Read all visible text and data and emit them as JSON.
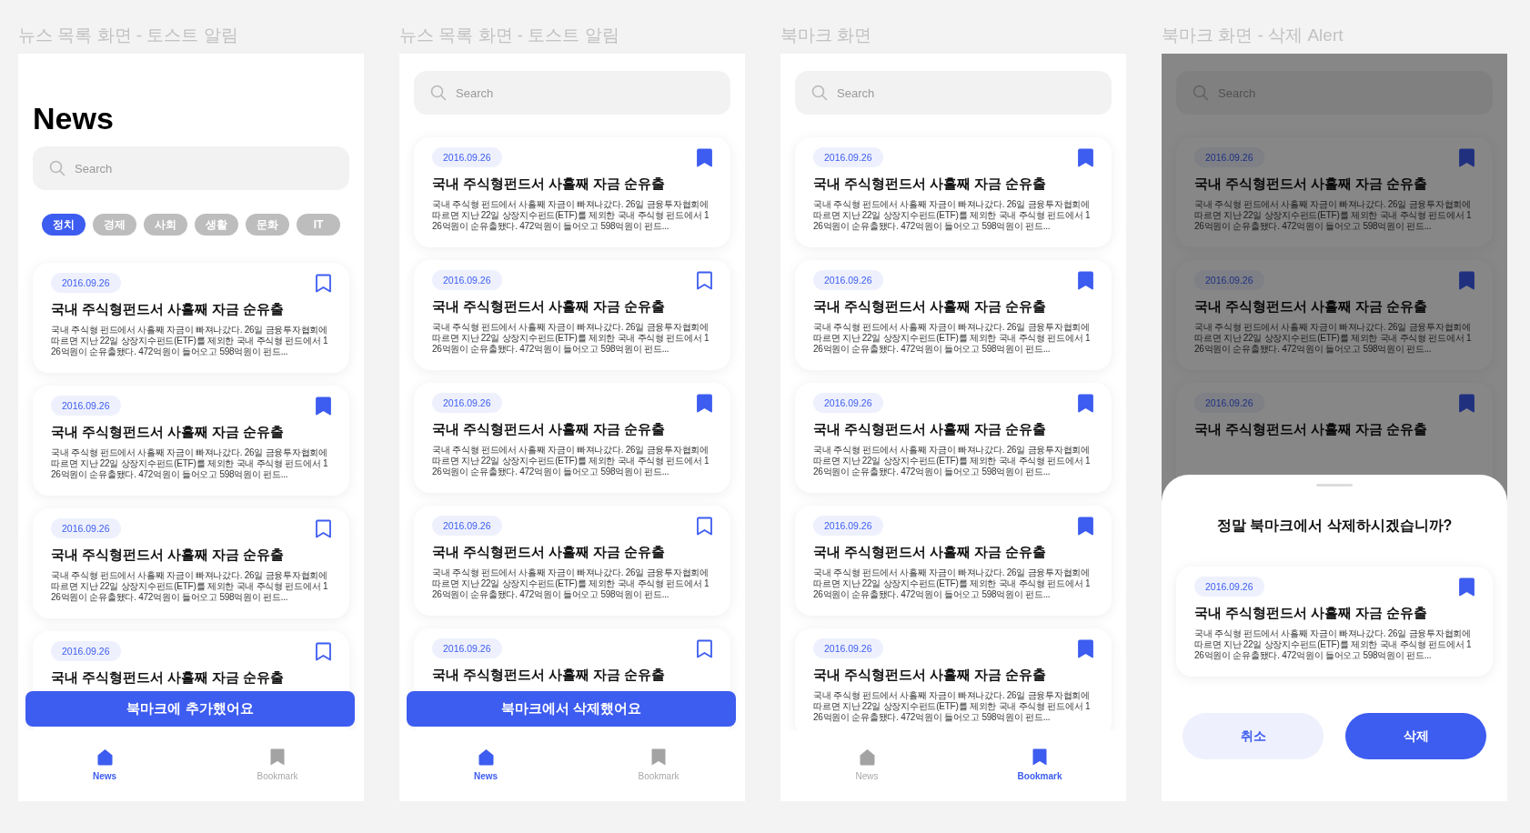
{
  "screens": [
    {
      "caption": "뉴스 목록 화면 - 토스트 알림",
      "header_title": "News",
      "search": {
        "placeholder": "Search"
      },
      "categories": [
        {
          "label": "정치",
          "selected": true
        },
        {
          "label": "경제",
          "selected": false
        },
        {
          "label": "사회",
          "selected": false
        },
        {
          "label": "생활",
          "selected": false
        },
        {
          "label": "문화",
          "selected": false
        },
        {
          "label": "IT",
          "selected": false
        }
      ],
      "articles": [
        {
          "date": "2016.09.26",
          "title": "국내 주식형펀드서 사흘째 자금 순유출",
          "body": "국내 주식형 펀드에서 사흘째 자금이 빠져나갔다. 26일 금융투자협회에 따르면 지난 22일 상장지수펀드(ETF)를 제외한 국내 주식형 펀드에서 126억원이 순유출됐다. 472억원이 들어오고 598억원이 펀드...",
          "bookmarked": false
        },
        {
          "date": "2016.09.26",
          "title": "국내 주식형펀드서 사흘째 자금 순유출",
          "body": "국내 주식형 펀드에서 사흘째 자금이 빠져나갔다. 26일 금융투자협회에 따르면 지난 22일 상장지수펀드(ETF)를 제외한 국내 주식형 펀드에서 126억원이 순유출됐다. 472억원이 들어오고 598억원이 펀드...",
          "bookmarked": true
        },
        {
          "date": "2016.09.26",
          "title": "국내 주식형펀드서 사흘째 자금 순유출",
          "body": "국내 주식형 펀드에서 사흘째 자금이 빠져나갔다. 26일 금융투자협회에 따르면 지난 22일 상장지수펀드(ETF)를 제외한 국내 주식형 펀드에서 126억원이 순유출됐다. 472억원이 들어오고 598억원이 펀드...",
          "bookmarked": false
        },
        {
          "date": "2016.09.26",
          "title": "국내 주식형펀드서 사흘째 자금 순유출",
          "bookmarked": false
        }
      ],
      "toast": "북마크에 추가했어요",
      "tabs": [
        {
          "label": "News",
          "selected": true
        },
        {
          "label": "Bookmark",
          "selected": false
        }
      ]
    },
    {
      "caption": "뉴스 목록 화면 - 토스트 알림",
      "search": {
        "placeholder": "Search"
      },
      "articles": [
        {
          "date": "2016.09.26",
          "title": "국내 주식형펀드서 사흘째 자금 순유출",
          "body": "국내 주식형 펀드에서 사흘째 자금이 빠져나갔다. 26일 금융투자협회에 따르면 지난 22일 상장지수펀드(ETF)를 제외한 국내 주식형 펀드에서 126억원이 순유출됐다. 472억원이 들어오고 598억원이 펀드...",
          "bookmarked": true
        },
        {
          "date": "2016.09.26",
          "title": "국내 주식형펀드서 사흘째 자금 순유출",
          "body": "국내 주식형 펀드에서 사흘째 자금이 빠져나갔다. 26일 금융투자협회에 따르면 지난 22일 상장지수펀드(ETF)를 제외한 국내 주식형 펀드에서 126억원이 순유출됐다. 472억원이 들어오고 598억원이 펀드...",
          "bookmarked": false
        },
        {
          "date": "2016.09.26",
          "title": "국내 주식형펀드서 사흘째 자금 순유출",
          "body": "국내 주식형 펀드에서 사흘째 자금이 빠져나갔다. 26일 금융투자협회에 따르면 지난 22일 상장지수펀드(ETF)를 제외한 국내 주식형 펀드에서 126억원이 순유출됐다. 472억원이 들어오고 598억원이 펀드...",
          "bookmarked": true
        },
        {
          "date": "2016.09.26",
          "title": "국내 주식형펀드서 사흘째 자금 순유출",
          "body": "국내 주식형 펀드에서 사흘째 자금이 빠져나갔다. 26일 금융투자협회에 따르면 지난 22일 상장지수펀드(ETF)를 제외한 국내 주식형 펀드에서 126억원이 순유출됐다. 472억원이 들어오고 598억원이 펀드...",
          "bookmarked": false
        },
        {
          "date": "2016.09.26",
          "title": "국내 주식형펀드서 사흘째 자금 순유출",
          "bookmarked": false
        }
      ],
      "toast": "북마크에서 삭제했어요",
      "tabs": [
        {
          "label": "News",
          "selected": true
        },
        {
          "label": "Bookmark",
          "selected": false
        }
      ]
    },
    {
      "caption": "북마크 화면",
      "search": {
        "placeholder": "Search"
      },
      "articles": [
        {
          "date": "2016.09.26",
          "title": "국내 주식형펀드서 사흘째 자금 순유출",
          "body": "국내 주식형 펀드에서 사흘째 자금이 빠져나갔다. 26일 금융투자협회에 따르면 지난 22일 상장지수펀드(ETF)를 제외한 국내 주식형 펀드에서 126억원이 순유출됐다. 472억원이 들어오고 598억원이 펀드...",
          "bookmarked": true
        },
        {
          "date": "2016.09.26",
          "title": "국내 주식형펀드서 사흘째 자금 순유출",
          "body": "국내 주식형 펀드에서 사흘째 자금이 빠져나갔다. 26일 금융투자협회에 따르면 지난 22일 상장지수펀드(ETF)를 제외한 국내 주식형 펀드에서 126억원이 순유출됐다. 472억원이 들어오고 598억원이 펀드...",
          "bookmarked": true
        },
        {
          "date": "2016.09.26",
          "title": "국내 주식형펀드서 사흘째 자금 순유출",
          "body": "국내 주식형 펀드에서 사흘째 자금이 빠져나갔다. 26일 금융투자협회에 따르면 지난 22일 상장지수펀드(ETF)를 제외한 국내 주식형 펀드에서 126억원이 순유출됐다. 472억원이 들어오고 598억원이 펀드...",
          "bookmarked": true
        },
        {
          "date": "2016.09.26",
          "title": "국내 주식형펀드서 사흘째 자금 순유출",
          "body": "국내 주식형 펀드에서 사흘째 자금이 빠져나갔다. 26일 금융투자협회에 따르면 지난 22일 상장지수펀드(ETF)를 제외한 국내 주식형 펀드에서 126억원이 순유출됐다. 472억원이 들어오고 598억원이 펀드...",
          "bookmarked": true
        },
        {
          "date": "2016.09.26",
          "title": "국내 주식형펀드서 사흘째 자금 순유출",
          "body": "국내 주식형 펀드에서 사흘째 자금이 빠져나갔다. 26일 금융투자협회에 따르면 지난 22일 상장지수펀드(ETF)를 제외한 국내 주식형 펀드에서 126억원이 순유출됐다. 472억원이 들어오고 598억원이 펀드...",
          "bookmarked": true
        }
      ],
      "tabs": [
        {
          "label": "News",
          "selected": false
        },
        {
          "label": "Bookmark",
          "selected": true
        }
      ]
    },
    {
      "caption": "북마크 화면 - 삭제 Alert",
      "search": {
        "placeholder": "Search"
      },
      "articles": [
        {
          "date": "2016.09.26",
          "title": "국내 주식형펀드서 사흘째 자금 순유출",
          "body": "국내 주식형 펀드에서 사흘째 자금이 빠져나갔다. 26일 금융투자협회에 따르면 지난 22일 상장지수펀드(ETF)를 제외한 국내 주식형 펀드에서 126억원이 순유출됐다. 472억원이 들어오고 598억원이 펀드...",
          "bookmarked": true
        },
        {
          "date": "2016.09.26",
          "title": "국내 주식형펀드서 사흘째 자금 순유출",
          "body": "국내 주식형 펀드에서 사흘째 자금이 빠져나갔다. 26일 금융투자협회에 따르면 지난 22일 상장지수펀드(ETF)를 제외한 국내 주식형 펀드에서 126억원이 순유출됐다. 472억원이 들어오고 598억원이 펀드...",
          "bookmarked": true
        },
        {
          "date": "2016.09.26",
          "title": "국내 주식형펀드서 사흘째 자금 순유출",
          "bookmarked": true
        }
      ],
      "dimmed": true,
      "dialog": {
        "question": "정말 북마크에서 삭제하시겠습니까?",
        "article": {
          "date": "2016.09.26",
          "title": "국내 주식형펀드서 사흘째 자금 순유출",
          "body": "국내 주식형 펀드에서 사흘째 자금이 빠져나갔다. 26일 금융투자협회에 따르면 지난 22일 상장지수펀드(ETF)를 제외한 국내 주식형 펀드에서 126억원이 순유출됐다. 472억원이 들어오고 598억원이 펀드...",
          "bookmarked": true
        },
        "buttons": [
          {
            "label": "취소",
            "kind": "secondary"
          },
          {
            "label": "삭제",
            "kind": "primary"
          }
        ]
      }
    }
  ]
}
